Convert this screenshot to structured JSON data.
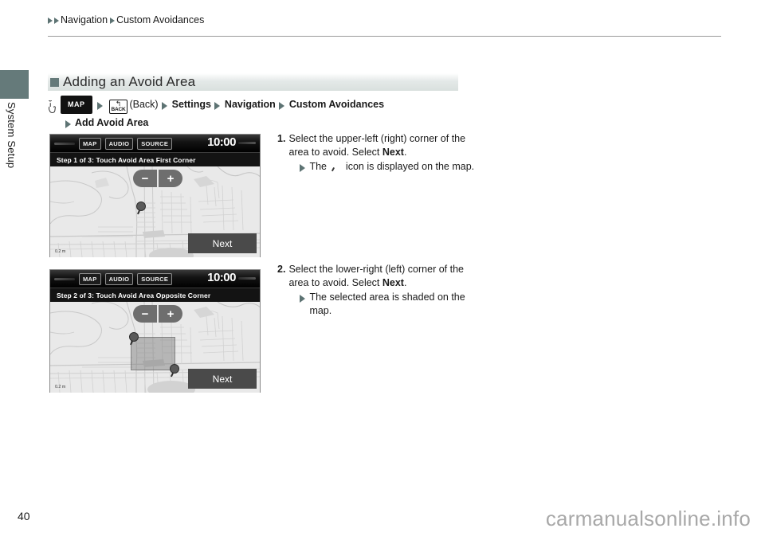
{
  "breadcrumb": {
    "item1": "Navigation",
    "item2": "Custom Avoidances"
  },
  "sidebar": {
    "tab_label": "System Setup",
    "tab_color": "#657a7a"
  },
  "section": {
    "title": "Adding an Avoid Area",
    "bullet_color": "#657a7a"
  },
  "path": {
    "map_button": "MAP",
    "back_arrow": "↰",
    "back_label": "BACK",
    "back_paren": "(Back)",
    "settings": "Settings",
    "navigation": "Navigation",
    "custom_avoidances": "Custom Avoidances",
    "add_avoid_area": "Add Avoid Area"
  },
  "screens": [
    {
      "map_btn": "MAP",
      "audio_btn": "AUDIO",
      "source_btn": "SOURCE",
      "clock": "10:00",
      "step_bar": "Step 1 of 3: Touch Avoid Area First Corner",
      "zoom_out": "−",
      "zoom_in": "+",
      "next_btn": "Next",
      "scale": "0.2 m"
    },
    {
      "map_btn": "MAP",
      "audio_btn": "AUDIO",
      "source_btn": "SOURCE",
      "clock": "10:00",
      "step_bar": "Step 2 of 3: Touch Avoid Area Opposite Corner",
      "zoom_out": "−",
      "zoom_in": "+",
      "next_btn": "Next",
      "scale": "0.2 m"
    }
  ],
  "steps": [
    {
      "num": "1.",
      "text_a": "Select the upper-left (right) corner of the area to avoid. Select ",
      "bold": "Next",
      "text_b": ".",
      "sub_a": "The ",
      "sub_b": " icon is displayed on the map."
    },
    {
      "num": "2.",
      "text_a": "Select the lower-right (left) corner of the area to avoid. Select ",
      "bold": "Next",
      "text_b": ".",
      "sub_a": "The selected area is shaded on the map.",
      "sub_b": ""
    }
  ],
  "footer": {
    "page_number": "40",
    "watermark": "carmanualsonline.info"
  }
}
